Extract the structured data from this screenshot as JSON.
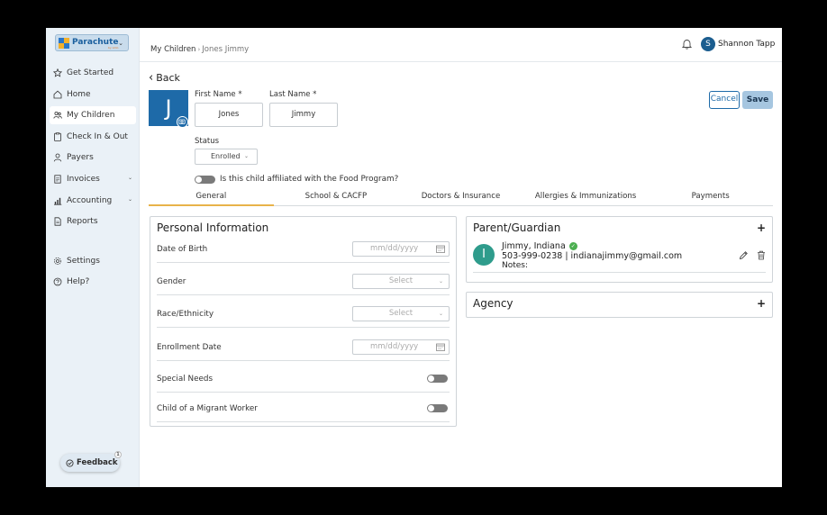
{
  "app": {
    "logo_text": "Parachute",
    "logo_sub": "by Lillio"
  },
  "sidebar": {
    "items": [
      {
        "label": "Get Started",
        "icon": "star-icon"
      },
      {
        "label": "Home",
        "icon": "home-icon"
      },
      {
        "label": "My Children",
        "icon": "children-icon",
        "active": true
      },
      {
        "label": "Check In & Out",
        "icon": "clipboard-icon"
      },
      {
        "label": "Payers",
        "icon": "user-icon"
      },
      {
        "label": "Invoices",
        "icon": "invoice-icon",
        "expandable": true
      },
      {
        "label": "Accounting",
        "icon": "chart-icon",
        "expandable": true
      },
      {
        "label": "Reports",
        "icon": "report-icon"
      },
      {
        "label": "Settings",
        "icon": "gear-icon"
      },
      {
        "label": "Help?",
        "icon": "help-icon"
      }
    ],
    "feedback_label": "Feedback",
    "feedback_badge": "1"
  },
  "header": {
    "breadcrumb_root": "My Children",
    "breadcrumb_current": "Jones Jimmy",
    "user_initial": "S",
    "user_name": "Shannon Tapp"
  },
  "form": {
    "back_label": "Back",
    "avatar_initial": "J",
    "first_name_label": "First Name *",
    "first_name_value": "Jones",
    "last_name_label": "Last Name *",
    "last_name_value": "Jimmy",
    "status_label": "Status",
    "status_value": "Enrolled",
    "food_program_label": "Is this child affiliated with the Food Program?",
    "food_program_enabled": false,
    "cancel_label": "Cancel",
    "save_label": "Save"
  },
  "tabs": [
    {
      "label": "General",
      "active": true
    },
    {
      "label": "School & CACFP"
    },
    {
      "label": "Doctors & Insurance"
    },
    {
      "label": "Allergies & Immunizations"
    },
    {
      "label": "Payments"
    }
  ],
  "personal": {
    "title": "Personal Information",
    "dob_label": "Date of Birth",
    "dob_placeholder": "mm/dd/yyyy",
    "gender_label": "Gender",
    "gender_placeholder": "Select",
    "race_label": "Race/Ethnicity",
    "race_placeholder": "Select",
    "enrollment_label": "Enrollment Date",
    "enrollment_placeholder": "mm/dd/yyyy",
    "special_needs_label": "Special Needs",
    "special_needs_enabled": false,
    "migrant_label": "Child of a Migrant Worker",
    "migrant_enabled": false
  },
  "guardian": {
    "title": "Parent/Guardian",
    "add_label": "+",
    "initial": "I",
    "name": "Jimmy, Indiana",
    "contact": "503-999-0238 | indianajimmy@gmail.com",
    "notes": "Notes:"
  },
  "agency": {
    "title": "Agency",
    "add_label": "+"
  },
  "colors": {
    "primary": "#1e6aa8",
    "sidebar_bg": "#eaf1f7",
    "tab_accent": "#e8b34a",
    "guardian_avatar": "#2f9c8c",
    "verified": "#4caf50"
  }
}
